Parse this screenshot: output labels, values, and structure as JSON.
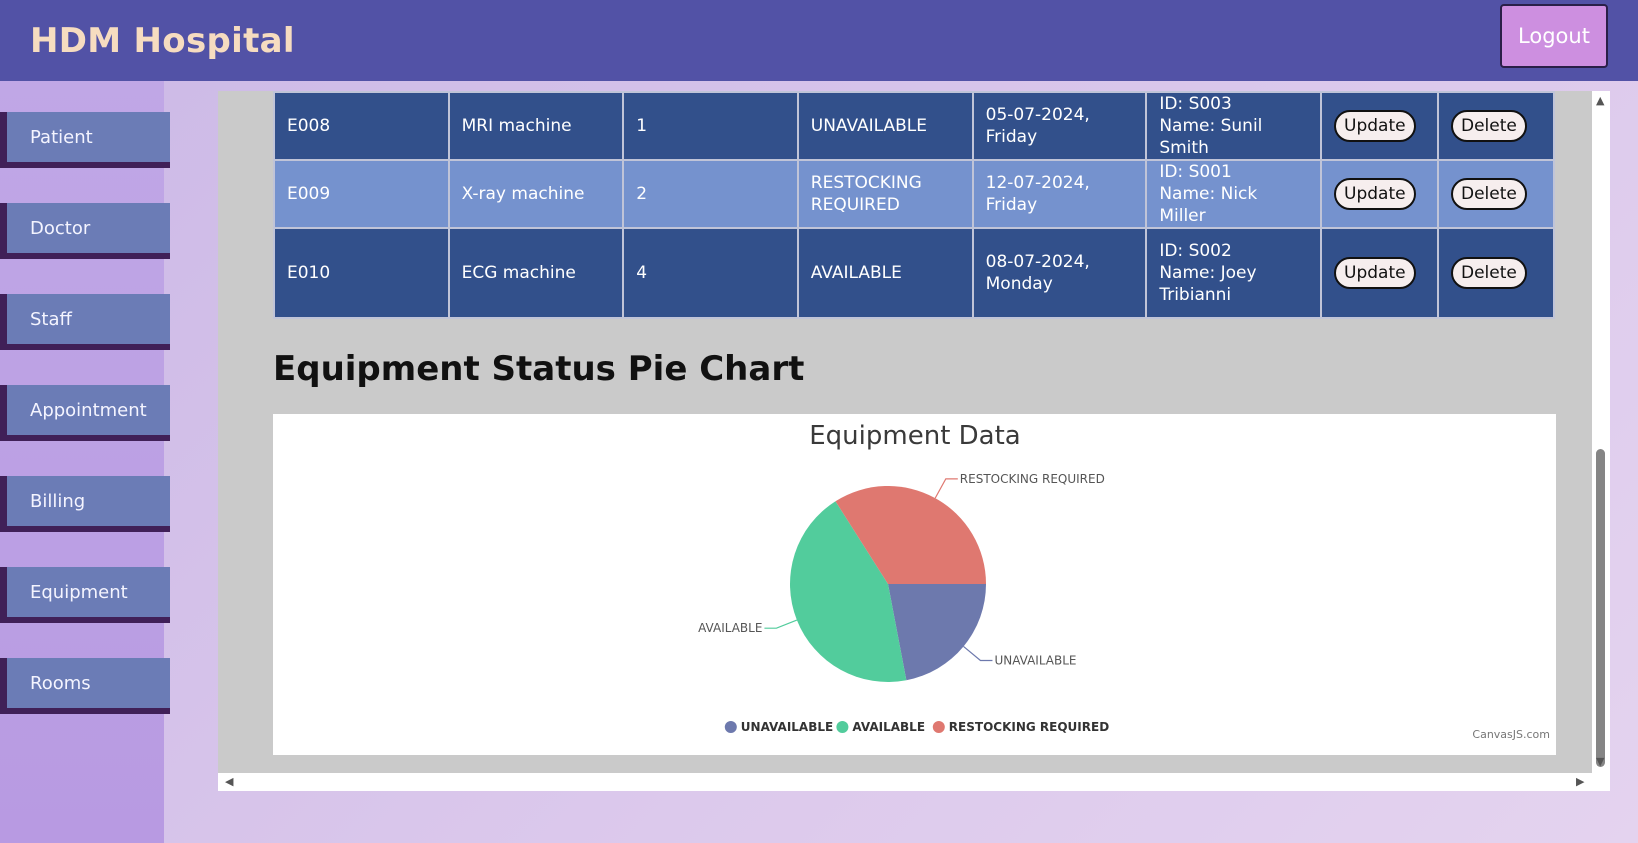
{
  "header": {
    "brand": "HDM Hospital",
    "logout_label": "Logout"
  },
  "sidebar": {
    "items": [
      {
        "label": "Patient"
      },
      {
        "label": "Doctor"
      },
      {
        "label": "Staff"
      },
      {
        "label": "Appointment"
      },
      {
        "label": "Billing"
      },
      {
        "label": "Equipment"
      },
      {
        "label": "Rooms"
      }
    ]
  },
  "table": {
    "rows": [
      {
        "id": "E008",
        "name": "MRI machine",
        "qty": "1",
        "status_line1": "UNAVAILABLE",
        "status_line2": "",
        "date_line1": "05-07-2024,",
        "date_line2": "Friday",
        "staff_line1": "ID: S003",
        "staff_line2": "Name: Sunil Smith",
        "staff_line3": "",
        "update": "Update",
        "delete": "Delete"
      },
      {
        "id": "E009",
        "name": "X-ray machine",
        "qty": "2",
        "status_line1": "RESTOCKING",
        "status_line2": "REQUIRED",
        "date_line1": "12-07-2024,",
        "date_line2": "Friday",
        "staff_line1": "ID: S001",
        "staff_line2": "Name: Nick Miller",
        "staff_line3": "",
        "update": "Update",
        "delete": "Delete"
      },
      {
        "id": "E010",
        "name": "ECG machine",
        "qty": "4",
        "status_line1": "AVAILABLE",
        "status_line2": "",
        "date_line1": "08-07-2024,",
        "date_line2": "Monday",
        "staff_line1": "ID: S002",
        "staff_line2": "Name: Joey",
        "staff_line3": "Tribianni",
        "update": "Update",
        "delete": "Delete"
      }
    ]
  },
  "section_title": "Equipment Status Pie Chart",
  "chart_data": {
    "type": "pie",
    "title": "Equipment Data",
    "series": [
      {
        "name": "UNAVAILABLE",
        "value": 22,
        "color": "#6d79ad"
      },
      {
        "name": "AVAILABLE",
        "value": 44,
        "color": "#52cc9c"
      },
      {
        "name": "RESTOCKING REQUIRED",
        "value": 34,
        "color": "#df7870"
      }
    ],
    "legend": "bottom",
    "credit": "CanvasJS.com"
  }
}
